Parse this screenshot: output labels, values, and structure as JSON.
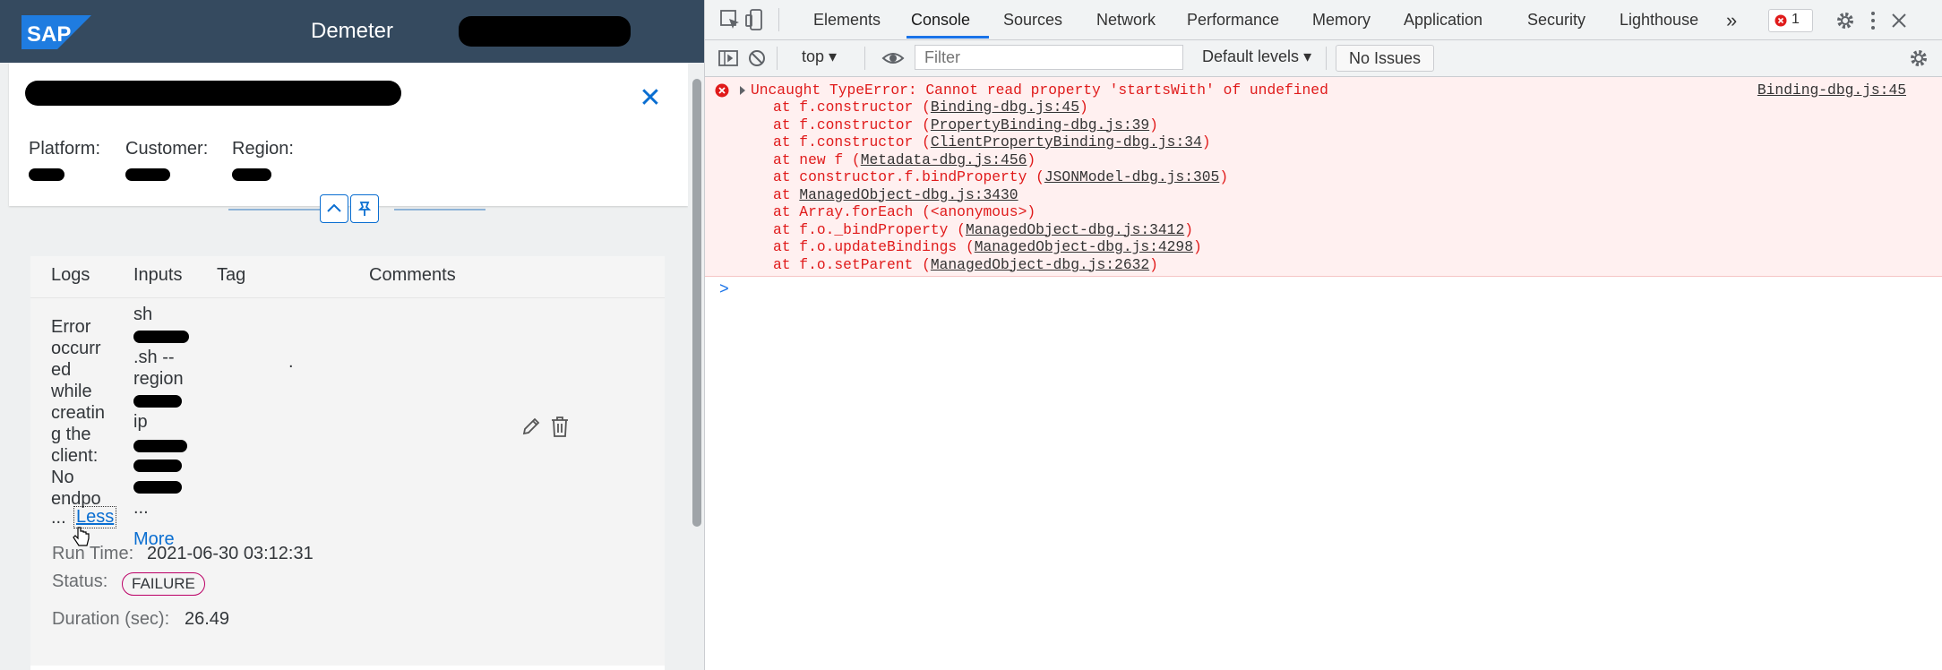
{
  "app": {
    "logo_text": "SAP",
    "title": "Demeter",
    "header": {
      "attributes": [
        {
          "label": "Platform:"
        },
        {
          "label": "Customer:"
        },
        {
          "label": "Region:"
        }
      ]
    },
    "table": {
      "columns": [
        "Logs",
        "Inputs",
        "Tag",
        "Comments"
      ],
      "row": {
        "log_text": "Error\noccurr\ned\nwhile\ncreatin\ng the\nclient:\nNo\nendpo",
        "log_ellipsis": "...",
        "less_label": "Less",
        "inputs_text": "sh\n\n.sh --\nregion\n\nip\n\n\n\n...",
        "more_label": "More",
        "tag_value": ".",
        "run_time_label": "Run Time:",
        "run_time_value": "2021-06-30 03:12:31",
        "status_label": "Status:",
        "status_value": "FAILURE",
        "duration_label": "Duration (sec):",
        "duration_value": "26.49"
      }
    },
    "colors": {
      "shell": "#354a5f",
      "link": "#0a6ed1",
      "failure": "#bb0066"
    }
  },
  "devtools": {
    "tabs": [
      "Elements",
      "Console",
      "Sources",
      "Network",
      "Performance",
      "Memory",
      "Application",
      "Security",
      "Lighthouse"
    ],
    "active_tab": "Console",
    "error_count": "1",
    "toolbar": {
      "context": "top",
      "filter_placeholder": "Filter",
      "levels": "Default levels",
      "issues": "No Issues"
    },
    "error": {
      "message": "Uncaught TypeError: Cannot read property 'startsWith' of undefined",
      "source": "Binding-dbg.js:45",
      "stack": [
        {
          "pre": "at f.constructor (",
          "link": "Binding-dbg.js:45",
          "post": ")"
        },
        {
          "pre": "at f.constructor (",
          "link": "PropertyBinding-dbg.js:39",
          "post": ")"
        },
        {
          "pre": "at f.constructor (",
          "link": "ClientPropertyBinding-dbg.js:34",
          "post": ")"
        },
        {
          "pre": "at new f (",
          "link": "Metadata-dbg.js:456",
          "post": ")"
        },
        {
          "pre": "at constructor.f.bindProperty (",
          "link": "JSONModel-dbg.js:305",
          "post": ")"
        },
        {
          "pre": "at ",
          "link": "ManagedObject-dbg.js:3430",
          "post": ""
        },
        {
          "pre": "at Array.forEach (<anonymous>)",
          "link": "",
          "post": ""
        },
        {
          "pre": "at f.o._bindProperty (",
          "link": "ManagedObject-dbg.js:3412",
          "post": ")"
        },
        {
          "pre": "at f.o.updateBindings (",
          "link": "ManagedObject-dbg.js:4298",
          "post": ")"
        },
        {
          "pre": "at f.o.setParent (",
          "link": "ManagedObject-dbg.js:2632",
          "post": ")"
        }
      ]
    },
    "prompt_symbol": ">"
  }
}
